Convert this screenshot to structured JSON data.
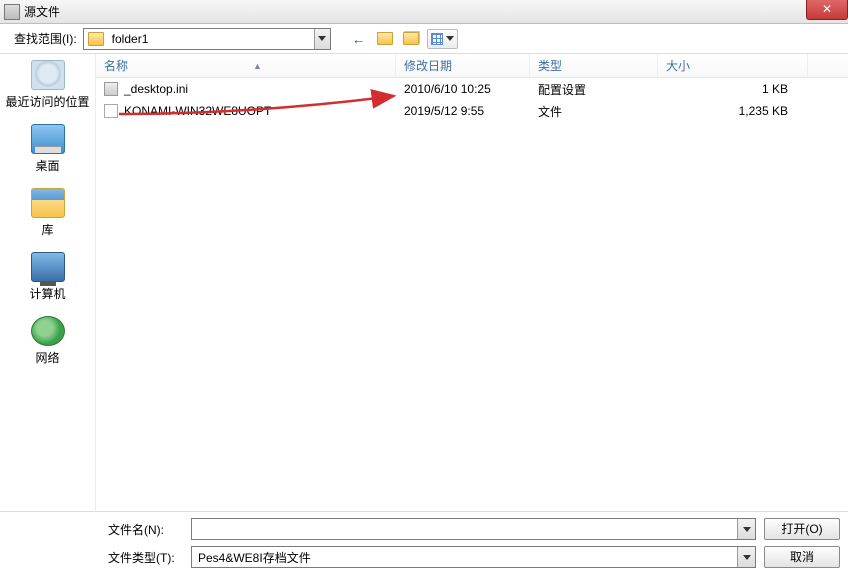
{
  "window": {
    "title": "源文件",
    "close": "✕"
  },
  "toolbar": {
    "lookin_label": "查找范围(I):",
    "path": "folder1",
    "icons": {
      "back": "back",
      "up": "up-folder",
      "new": "new-folder",
      "views": "views"
    }
  },
  "columns": {
    "name": "名称",
    "date": "修改日期",
    "type": "类型",
    "size": "大小"
  },
  "files": [
    {
      "name": "_desktop.ini",
      "date": "2010/6/10 10:25",
      "type": "配置设置",
      "size": "1 KB",
      "icon": "cfg"
    },
    {
      "name": "KONAMI-WIN32WE8UOPT",
      "date": "2019/5/12 9:55",
      "type": "文件",
      "size": "1,235 KB",
      "icon": "file"
    }
  ],
  "places": [
    {
      "key": "recent",
      "label": "最近访问的位置"
    },
    {
      "key": "desktop",
      "label": "桌面"
    },
    {
      "key": "lib",
      "label": "库"
    },
    {
      "key": "comp",
      "label": "计算机"
    },
    {
      "key": "net",
      "label": "网络"
    }
  ],
  "bottom": {
    "filename_label": "文件名(N):",
    "filename_value": "",
    "filetype_label": "文件类型(T):",
    "filetype_value": "Pes4&WE8I存档文件",
    "open": "打开(O)",
    "cancel": "取消"
  },
  "colors": {
    "arrow": "#d22e2e"
  }
}
